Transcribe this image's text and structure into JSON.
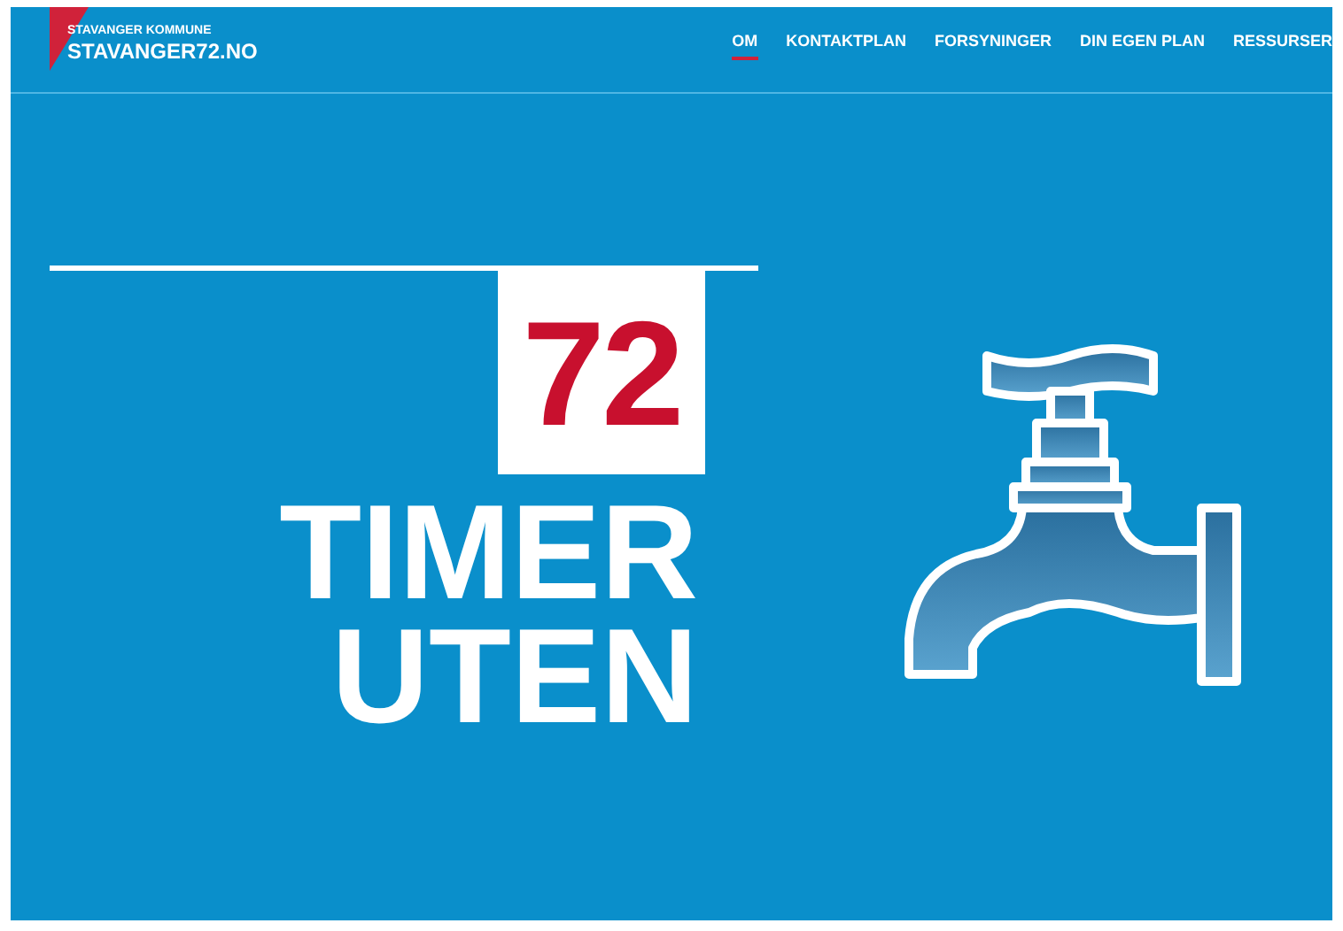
{
  "header": {
    "organization": "STAVANGER KOMMUNE",
    "site_name": "STAVANGER72.NO"
  },
  "nav": [
    {
      "label": "OM",
      "selected": true
    },
    {
      "label": "KONTAKTPLAN",
      "selected": false
    },
    {
      "label": "FORSYNINGER",
      "selected": false
    },
    {
      "label": "DIN EGEN PLAN",
      "selected": false
    },
    {
      "label": "RESSURSER",
      "selected": false
    }
  ],
  "hero": {
    "number": "72",
    "lines": [
      "TIMER",
      "UTEN"
    ]
  }
}
